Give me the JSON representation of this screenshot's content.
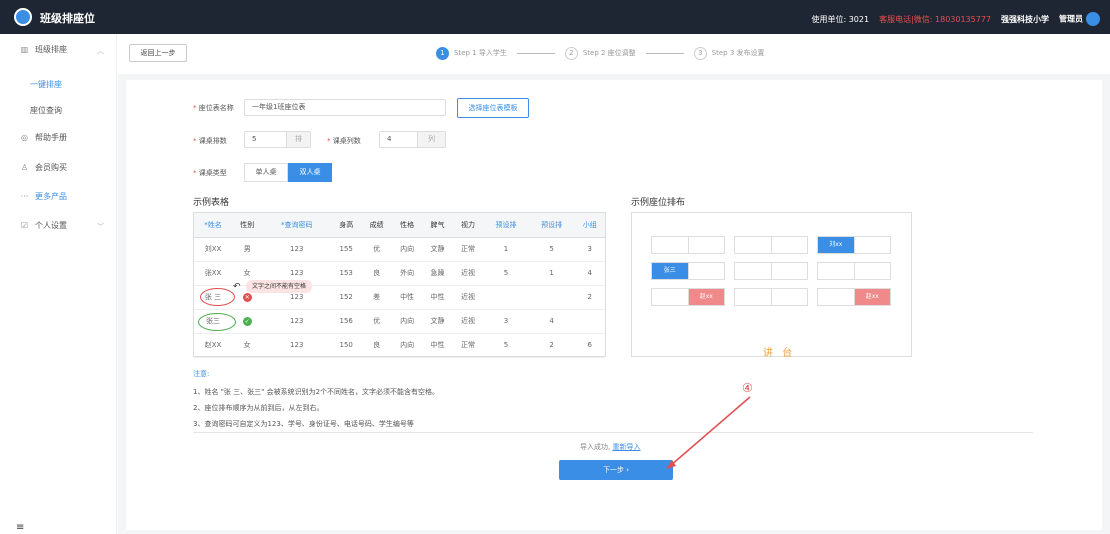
{
  "app": {
    "title": "班级排座位"
  },
  "header": {
    "unit": "使用单位: 3021",
    "hotline": "客服电话|微信: 18030135777",
    "school": "强强科技小学",
    "user": "管理员"
  },
  "sidebar": {
    "items": [
      {
        "label": "班级排座",
        "icon": "building-icon"
      },
      {
        "label": "一键排座",
        "active": true
      },
      {
        "label": "座位查询"
      },
      {
        "label": "帮助手册",
        "icon": "help-icon"
      },
      {
        "label": "会员购买",
        "icon": "user-icon"
      },
      {
        "label": "更多产品",
        "icon": "more-icon"
      },
      {
        "label": "个人设置",
        "icon": "edit-icon"
      }
    ]
  },
  "toolbar": {
    "back": "返回上一步"
  },
  "steps": [
    {
      "num": "1",
      "label": "Step 1 导入学生"
    },
    {
      "num": "2",
      "label": "Step 2 座位调整"
    },
    {
      "num": "3",
      "label": "Step 3 发布设置"
    }
  ],
  "form": {
    "name_label": "座位表名称",
    "name_value": "一年级1班座位表",
    "template_btn": "选择座位表模板",
    "rows_label": "课桌排数",
    "rows_value": "5",
    "rows_unit": "排",
    "cols_label": "课桌列数",
    "cols_value": "4",
    "cols_unit": "列",
    "type_label": "课桌类型",
    "type_single": "单人桌",
    "type_double": "双人桌"
  },
  "example_table": {
    "title": "示例表格",
    "headers": [
      "*姓名",
      "性别",
      "*查询密码",
      "身高",
      "成绩",
      "性格",
      "脾气",
      "视力",
      "预设排",
      "预设排",
      "小组"
    ],
    "rows": [
      [
        "刘XX",
        "男",
        "123",
        "155",
        "优",
        "内向",
        "文静",
        "正常",
        "1",
        "5",
        "3"
      ],
      [
        "张XX",
        "女",
        "123",
        "153",
        "良",
        "外向",
        "急躁",
        "近视",
        "5",
        "1",
        "4"
      ],
      [
        "张 三",
        "",
        "123",
        "152",
        "差",
        "中性",
        "中性",
        "近视",
        "",
        "",
        "2"
      ],
      [
        "张三",
        "",
        "123",
        "156",
        "优",
        "内向",
        "文静",
        "近视",
        "3",
        "4",
        ""
      ],
      [
        "赵XX",
        "女",
        "123",
        "150",
        "良",
        "内向",
        "中性",
        "正常",
        "5",
        "2",
        "6"
      ]
    ],
    "tip": "文字之间不能有空格"
  },
  "seat_example": {
    "title": "示例座位排布",
    "names": {
      "liu": "刘xx",
      "zhang": "张三",
      "zhao": "赵xx"
    },
    "podium": "讲 台"
  },
  "notes": {
    "title": "注意:",
    "items": [
      "1、姓名 \"张 三、张三\" 会被系统识别为2个不同姓名，文字必须不能含有空格。",
      "2、座位排布顺序为从前到后，从左到右。",
      "3、查询密码可自定义为123、学号、身份证号、电话号码、学生编号等"
    ]
  },
  "footer": {
    "import_ok": "导入成功,",
    "reimport": "重新导入",
    "next": "下一步 ›"
  },
  "annotation": {
    "marker": "④"
  },
  "colors": {
    "accent": "#3a8ee6",
    "topbar": "#1f2633",
    "danger": "#e05050",
    "ok": "#4caf50"
  }
}
